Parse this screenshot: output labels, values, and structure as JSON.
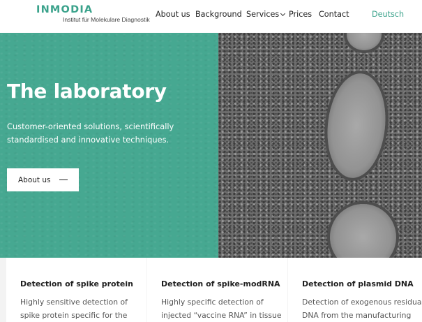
{
  "header": {
    "logo": {
      "word": "INMODIA",
      "subtitle": "Institut für Molekulare Diagnostik"
    },
    "nav": [
      {
        "label": "About us"
      },
      {
        "label": "Background"
      },
      {
        "label": "Services"
      },
      {
        "label": "Prices"
      },
      {
        "label": "Contact"
      }
    ],
    "language": "Deutsch",
    "accent_color": "#3aa28b"
  },
  "hero": {
    "title": "The laboratory",
    "text": "Customer-oriented solutions, scientifically standardised and innovative techniques.",
    "button_label": "About us",
    "background_color": "#46a891",
    "prev_icon": "chevron-left-icon",
    "image": "microscopy-tissue-image"
  },
  "cards": [
    {
      "title": "Detection of spike protein",
      "lines": [
        "Highly sensitive detection of",
        "spike protein specific for the"
      ]
    },
    {
      "title": "Detection of spike-modRNA",
      "lines": [
        "Highly specific detection of",
        "injected “vaccine RNA” in tissue"
      ]
    },
    {
      "title": "Detection of plasmid DNA",
      "lines": [
        "Detection of exogenous residual",
        "DNA from the manufacturing"
      ]
    }
  ]
}
